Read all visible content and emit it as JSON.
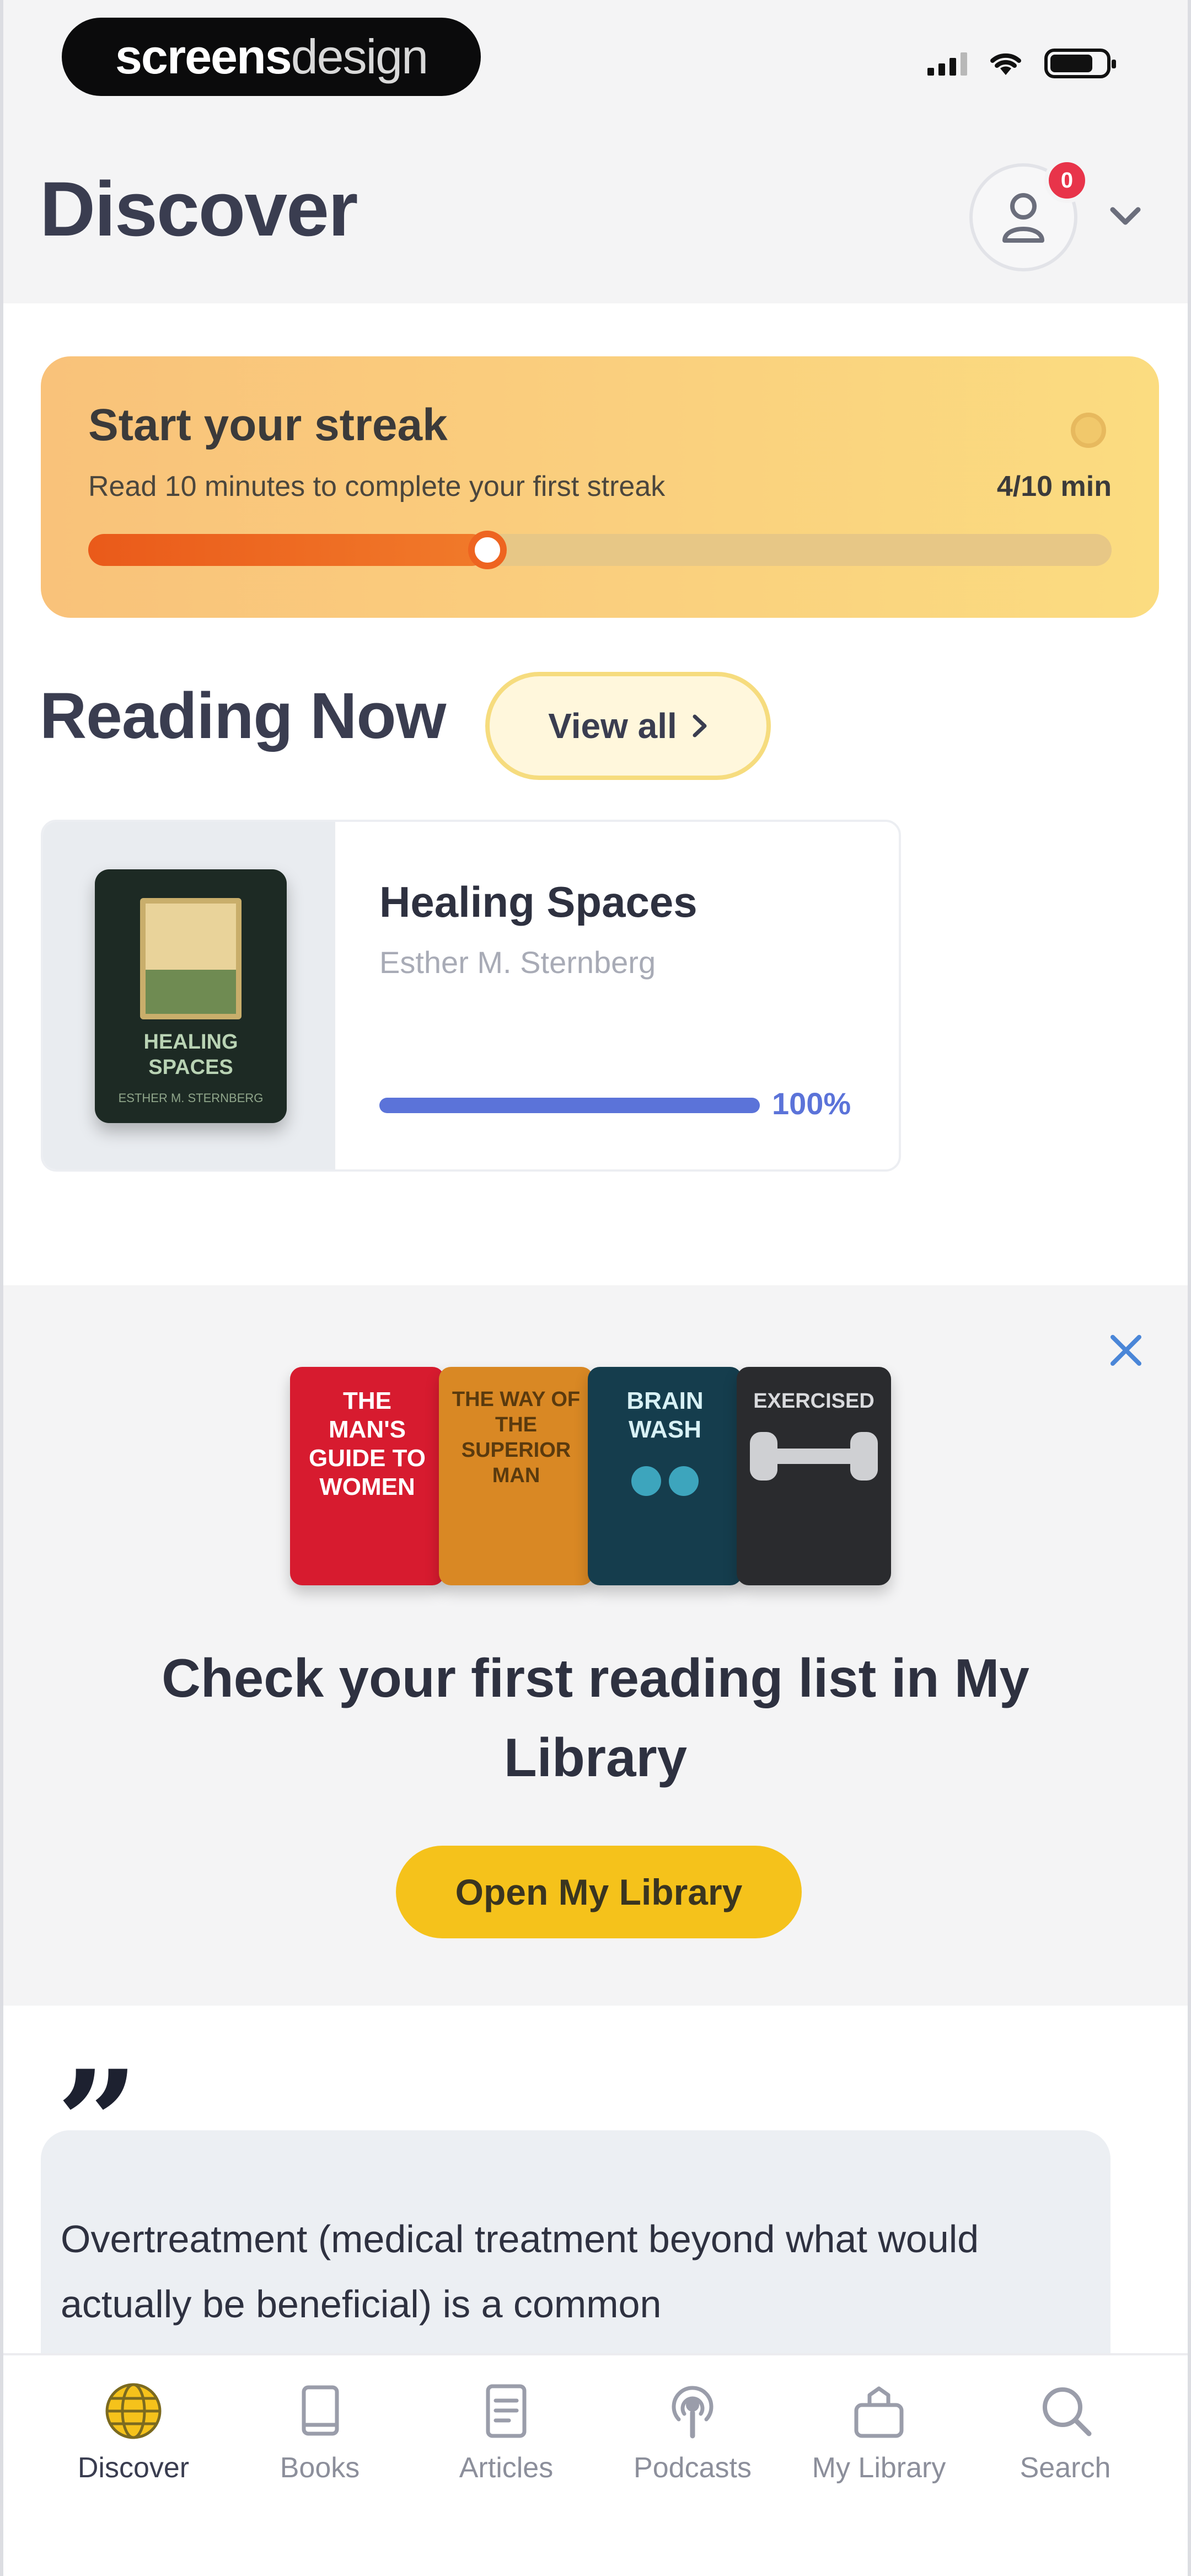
{
  "status_bar": {
    "brand_part1": "screens",
    "brand_part2": "design"
  },
  "header": {
    "title": "Discover",
    "notification_count": "0"
  },
  "streak": {
    "title": "Start your streak",
    "subtitle": "Read 10 minutes to complete your first streak",
    "value_text": "4/10 min",
    "progress": 0.39
  },
  "reading_now": {
    "title": "Reading Now",
    "view_all_label": "View all",
    "book": {
      "title": "Healing Spaces",
      "author": "Esther M. Sternberg",
      "progress_text": "100%",
      "progress": 1.0,
      "cover_title_line1": "HEALING",
      "cover_title_line2": "SPACES",
      "cover_author": "ESTHER M. STERNBERG"
    }
  },
  "library_promo": {
    "covers": [
      {
        "text": "THE MAN'S GUIDE TO WOMEN"
      },
      {
        "text": "THE WAY OF THE SUPERIOR MAN"
      },
      {
        "text": "BRAIN WASH"
      },
      {
        "text": "EXERCISED"
      }
    ],
    "text": "Check your first reading list in My Library",
    "button_label": "Open My Library"
  },
  "quote": {
    "mark": "”",
    "text": "Overtreatment (medical treatment beyond what would actually be beneficial) is a common"
  },
  "tab_bar": {
    "items": [
      {
        "label": "Discover",
        "icon": "globe-icon",
        "active": true
      },
      {
        "label": "Books",
        "icon": "book-icon",
        "active": false
      },
      {
        "label": "Articles",
        "icon": "article-icon",
        "active": false
      },
      {
        "label": "Podcasts",
        "icon": "podcast-icon",
        "active": false
      },
      {
        "label": "My Library",
        "icon": "library-icon",
        "active": false
      },
      {
        "label": "Search",
        "icon": "search-icon",
        "active": false
      }
    ]
  },
  "colors": {
    "accent_yellow": "#f5c21b",
    "streak_orange": "#ea5a1a",
    "progress_blue": "#5b73d9",
    "badge_red": "#e8344a"
  }
}
